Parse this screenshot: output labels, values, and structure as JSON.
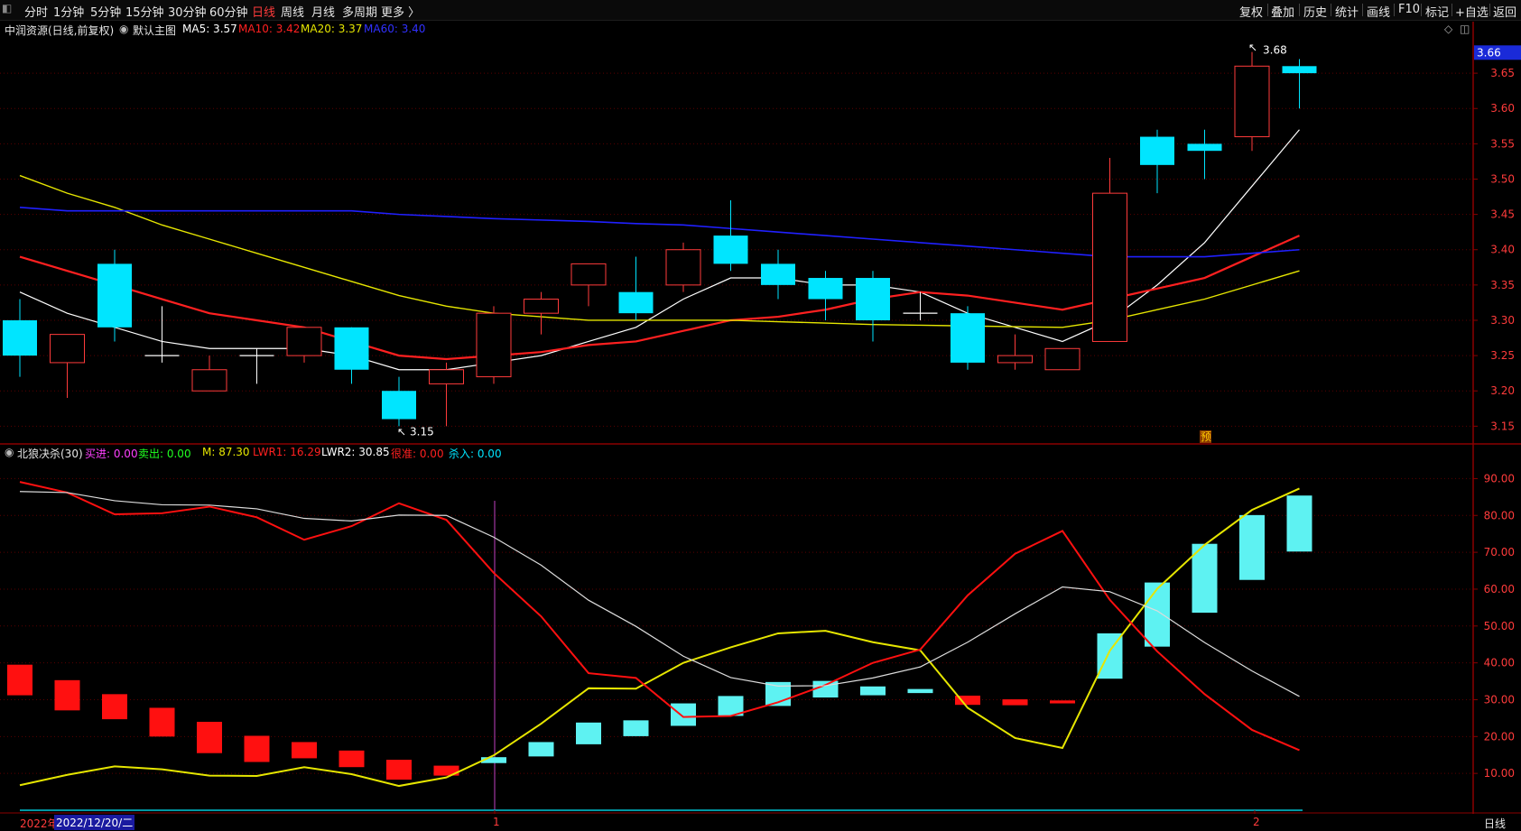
{
  "toolbar": {
    "left_items": [
      "分时",
      "1分钟",
      "5分钟",
      "15分钟",
      "30分钟",
      "60分钟",
      "日线",
      "周线",
      "月线",
      "多周期",
      "更多 〉"
    ],
    "active": "日线",
    "right_items": [
      "复权",
      "叠加",
      "历史",
      "统计",
      "画线",
      "F10",
      "标记",
      "+自选",
      "返回"
    ]
  },
  "main_info": {
    "title": "中润资源(日线,前复权)",
    "chart_label": "默认主图",
    "ma5": "MA5: 3.57",
    "ma10": "MA10: 3.42",
    "ma20": "MA20: 3.37",
    "ma60": "MA60: 3.40"
  },
  "indicator_info": {
    "name": "北狼决杀(30)",
    "buy": "买进: 0.00",
    "sell": "卖出: 0.00",
    "m": "M: 87.30",
    "lwr1": "LWR1: 16.29",
    "lwr2": "LWR2: 30.85",
    "alert": "很准: 0.00",
    "kill": "杀入: 0.00"
  },
  "price_axis": {
    "current": "3.66",
    "ticks": [
      "3.65",
      "3.60",
      "3.55",
      "3.50",
      "3.45",
      "3.40",
      "3.35",
      "3.30",
      "3.25",
      "3.20",
      "3.15"
    ]
  },
  "indicator_axis": {
    "ticks": [
      "90.00",
      "80.00",
      "70.00",
      "60.00",
      "50.00",
      "40.00",
      "30.00",
      "20.00",
      "10.00"
    ]
  },
  "annotations": {
    "high": "3.68",
    "low": "3.15",
    "forecast": "预"
  },
  "date_bar": {
    "year": "2022年",
    "selected_date": "2022/12/20/二",
    "mark1": "1",
    "mark2": "2",
    "period_button": "日线"
  },
  "colors": {
    "up": "#ff3b3b",
    "down": "#00e5ff",
    "ma5": "#ffffff",
    "ma10": "#ff2020",
    "ma20": "#e6e600",
    "ma60": "#2020ff"
  },
  "chart_data": [
    {
      "type": "candlestick",
      "ylim": [
        3.13,
        3.7
      ],
      "candles": [
        {
          "o": 3.3,
          "c": 3.25,
          "h": 3.33,
          "l": 3.22
        },
        {
          "o": 3.24,
          "c": 3.28,
          "h": 3.28,
          "l": 3.19
        },
        {
          "o": 3.38,
          "c": 3.29,
          "h": 3.4,
          "l": 3.27
        },
        {
          "o": 3.25,
          "c": 3.25,
          "h": 3.32,
          "l": 3.24
        },
        {
          "o": 3.2,
          "c": 3.23,
          "h": 3.25,
          "l": 3.2
        },
        {
          "o": 3.25,
          "c": 3.25,
          "h": 3.26,
          "l": 3.21
        },
        {
          "o": 3.25,
          "c": 3.29,
          "h": 3.29,
          "l": 3.24
        },
        {
          "o": 3.29,
          "c": 3.23,
          "h": 3.29,
          "l": 3.21
        },
        {
          "o": 3.2,
          "c": 3.16,
          "h": 3.22,
          "l": 3.15
        },
        {
          "o": 3.21,
          "c": 3.23,
          "h": 3.24,
          "l": 3.15
        },
        {
          "o": 3.22,
          "c": 3.31,
          "h": 3.32,
          "l": 3.21
        },
        {
          "o": 3.31,
          "c": 3.33,
          "h": 3.34,
          "l": 3.28
        },
        {
          "o": 3.35,
          "c": 3.38,
          "h": 3.38,
          "l": 3.32
        },
        {
          "o": 3.34,
          "c": 3.31,
          "h": 3.39,
          "l": 3.3
        },
        {
          "o": 3.35,
          "c": 3.4,
          "h": 3.41,
          "l": 3.34
        },
        {
          "o": 3.42,
          "c": 3.38,
          "h": 3.47,
          "l": 3.37
        },
        {
          "o": 3.38,
          "c": 3.35,
          "h": 3.4,
          "l": 3.33
        },
        {
          "o": 3.36,
          "c": 3.33,
          "h": 3.37,
          "l": 3.3
        },
        {
          "o": 3.36,
          "c": 3.3,
          "h": 3.37,
          "l": 3.27
        },
        {
          "o": 3.31,
          "c": 3.31,
          "h": 3.34,
          "l": 3.3
        },
        {
          "o": 3.31,
          "c": 3.24,
          "h": 3.32,
          "l": 3.23
        },
        {
          "o": 3.24,
          "c": 3.25,
          "h": 3.28,
          "l": 3.23
        },
        {
          "o": 3.23,
          "c": 3.26,
          "h": 3.26,
          "l": 3.23
        },
        {
          "o": 3.27,
          "c": 3.48,
          "h": 3.53,
          "l": 3.27
        },
        {
          "o": 3.56,
          "c": 3.52,
          "h": 3.57,
          "l": 3.48
        },
        {
          "o": 3.55,
          "c": 3.54,
          "h": 3.57,
          "l": 3.5
        },
        {
          "o": 3.56,
          "c": 3.66,
          "h": 3.68,
          "l": 3.54
        },
        {
          "o": 3.66,
          "c": 3.65,
          "h": 3.67,
          "l": 3.6
        }
      ],
      "series": [
        {
          "name": "MA5",
          "values": [
            3.34,
            3.31,
            3.29,
            3.27,
            3.26,
            3.26,
            3.26,
            3.25,
            3.23,
            3.23,
            3.24,
            3.25,
            3.27,
            3.29,
            3.33,
            3.36,
            3.36,
            3.35,
            3.35,
            3.34,
            3.31,
            3.29,
            3.27,
            3.3,
            3.35,
            3.41,
            3.49,
            3.57
          ]
        },
        {
          "name": "MA10",
          "values": [
            3.39,
            3.37,
            3.35,
            3.33,
            3.31,
            3.3,
            3.29,
            3.27,
            3.25,
            3.245,
            3.25,
            3.255,
            3.265,
            3.27,
            3.285,
            3.3,
            3.305,
            3.315,
            3.33,
            3.34,
            3.335,
            3.325,
            3.315,
            3.33,
            3.345,
            3.36,
            3.39,
            3.42
          ]
        },
        {
          "name": "MA20",
          "values": [
            3.505,
            3.48,
            3.46,
            3.435,
            3.415,
            3.395,
            3.375,
            3.355,
            3.335,
            3.32,
            3.31,
            3.305,
            3.3,
            3.3,
            3.3,
            3.3,
            3.298,
            3.296,
            3.294,
            3.293,
            3.292,
            3.291,
            3.29,
            3.3,
            3.315,
            3.33,
            3.35,
            3.37
          ]
        },
        {
          "name": "MA60",
          "values": [
            3.46,
            3.455,
            3.455,
            3.455,
            3.455,
            3.455,
            3.455,
            3.455,
            3.45,
            3.447,
            3.444,
            3.442,
            3.44,
            3.437,
            3.435,
            3.43,
            3.425,
            3.42,
            3.415,
            3.41,
            3.405,
            3.4,
            3.395,
            3.39,
            3.39,
            3.39,
            3.395,
            3.4
          ]
        }
      ]
    },
    {
      "type": "bar",
      "ylim": [
        0,
        95
      ],
      "bars": [
        {
          "top": 39.5,
          "bottom": 31.2,
          "color": "red"
        },
        {
          "top": 35.3,
          "bottom": 27.1,
          "color": "red"
        },
        {
          "top": 31.5,
          "bottom": 24.7,
          "color": "red"
        },
        {
          "top": 27.8,
          "bottom": 20.0,
          "color": "red"
        },
        {
          "top": 24.0,
          "bottom": 15.5,
          "color": "red"
        },
        {
          "top": 20.2,
          "bottom": 13.1,
          "color": "red"
        },
        {
          "top": 18.5,
          "bottom": 14.1,
          "color": "red"
        },
        {
          "top": 16.2,
          "bottom": 11.7,
          "color": "red"
        },
        {
          "top": 13.7,
          "bottom": 8.3,
          "color": "red"
        },
        {
          "top": 12.1,
          "bottom": 9.4,
          "color": "red"
        },
        {
          "top": 14.4,
          "bottom": 12.8,
          "color": "cyan"
        },
        {
          "top": 18.5,
          "bottom": 14.6,
          "color": "cyan"
        },
        {
          "top": 23.8,
          "bottom": 17.9,
          "color": "cyan"
        },
        {
          "top": 24.4,
          "bottom": 20.1,
          "color": "cyan"
        },
        {
          "top": 29.0,
          "bottom": 22.9,
          "color": "cyan"
        },
        {
          "top": 31.0,
          "bottom": 25.6,
          "color": "cyan"
        },
        {
          "top": 34.8,
          "bottom": 28.3,
          "color": "cyan"
        },
        {
          "top": 35.1,
          "bottom": 30.6,
          "color": "cyan"
        },
        {
          "top": 33.6,
          "bottom": 31.2,
          "color": "cyan"
        },
        {
          "top": 32.9,
          "bottom": 31.8,
          "color": "cyan"
        },
        {
          "top": 31.1,
          "bottom": 28.6,
          "color": "red"
        },
        {
          "top": 30.1,
          "bottom": 28.5,
          "color": "red"
        },
        {
          "top": 29.8,
          "bottom": 29.0,
          "color": "red"
        },
        {
          "top": 48.0,
          "bottom": 35.7,
          "color": "cyan"
        },
        {
          "top": 61.8,
          "bottom": 44.4,
          "color": "cyan"
        },
        {
          "top": 72.3,
          "bottom": 53.6,
          "color": "cyan"
        },
        {
          "top": 80.1,
          "bottom": 62.5,
          "color": "cyan"
        },
        {
          "top": 85.4,
          "bottom": 70.2,
          "color": "cyan"
        }
      ],
      "series": [
        {
          "name": "M",
          "values": [
            6.8,
            9.6,
            11.9,
            11.1,
            9.4,
            9.3,
            11.7,
            9.8,
            6.6,
            8.9,
            14.9,
            23.5,
            33.1,
            33.0,
            40.0,
            44.2,
            48.0,
            48.7,
            45.6,
            43.4,
            27.8,
            19.6,
            16.9,
            43.3,
            60.1,
            72.0,
            81.5,
            87.3
          ]
        },
        {
          "name": "LWR1",
          "values": [
            89.1,
            86.2,
            80.3,
            80.6,
            82.4,
            79.5,
            73.4,
            77.1,
            83.3,
            78.8,
            64.4,
            52.6,
            37.2,
            35.9,
            25.3,
            25.6,
            29.3,
            34.0,
            40.0,
            43.6,
            58.3,
            69.6,
            75.8,
            57.1,
            43.1,
            31.5,
            21.8,
            16.3
          ]
        },
        {
          "name": "LWR2",
          "values": [
            86.5,
            86.2,
            84.0,
            82.9,
            82.8,
            81.8,
            79.2,
            78.5,
            80.1,
            80.0,
            74.1,
            66.5,
            57.0,
            49.9,
            41.8,
            36.0,
            33.7,
            33.8,
            35.9,
            38.9,
            45.6,
            53.3,
            60.6,
            59.3,
            54.1,
            45.5,
            37.8,
            30.9
          ]
        }
      ]
    }
  ]
}
